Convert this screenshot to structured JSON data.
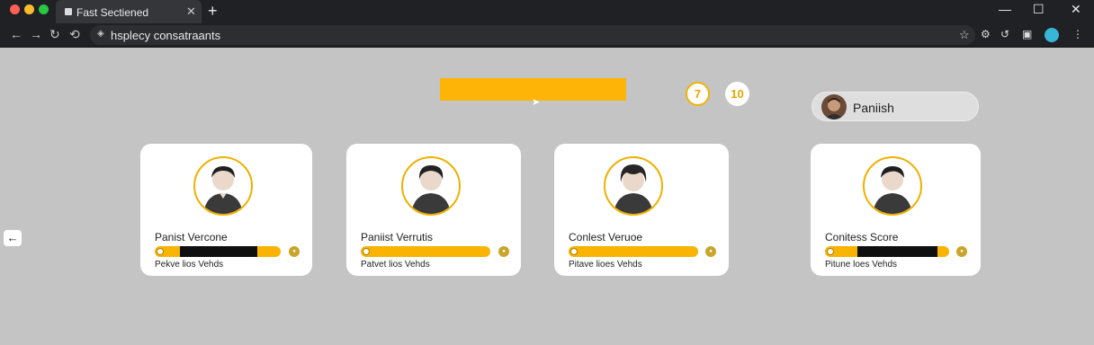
{
  "browser": {
    "tab_title": "Fast Sectiened",
    "url": "hsplecy consatraants",
    "icons": [
      "close-icon",
      "plus-icon",
      "minimize-icon",
      "maximize-icon",
      "back-icon",
      "forward-icon",
      "reload-icon",
      "star-icon",
      "extension-icon",
      "menu-icon"
    ]
  },
  "page": {
    "stats": [
      {
        "value": "7",
        "style": "outlined"
      },
      {
        "value": "10",
        "style": "filled"
      }
    ],
    "user": {
      "name": "Paniish"
    },
    "cards": [
      {
        "name": "Panist Vercone",
        "subtitle": "Pekve lios Vehds",
        "progress": 0.63,
        "progress_fill_start": 0.2
      },
      {
        "name": "Paniist Verrutis",
        "subtitle": "Patvet lios Vehds",
        "progress": 0.0,
        "progress_fill_start": 0
      },
      {
        "name": "Conlest Veruoe",
        "subtitle": "Pitave lioes Vehds",
        "progress": 0.0,
        "progress_fill_start": 0
      },
      {
        "name": "Conitess Score",
        "subtitle": "Pitune loes Vehds",
        "progress": 0.68,
        "progress_fill_start": 0.25
      }
    ],
    "accent_color": "#fdb407"
  }
}
